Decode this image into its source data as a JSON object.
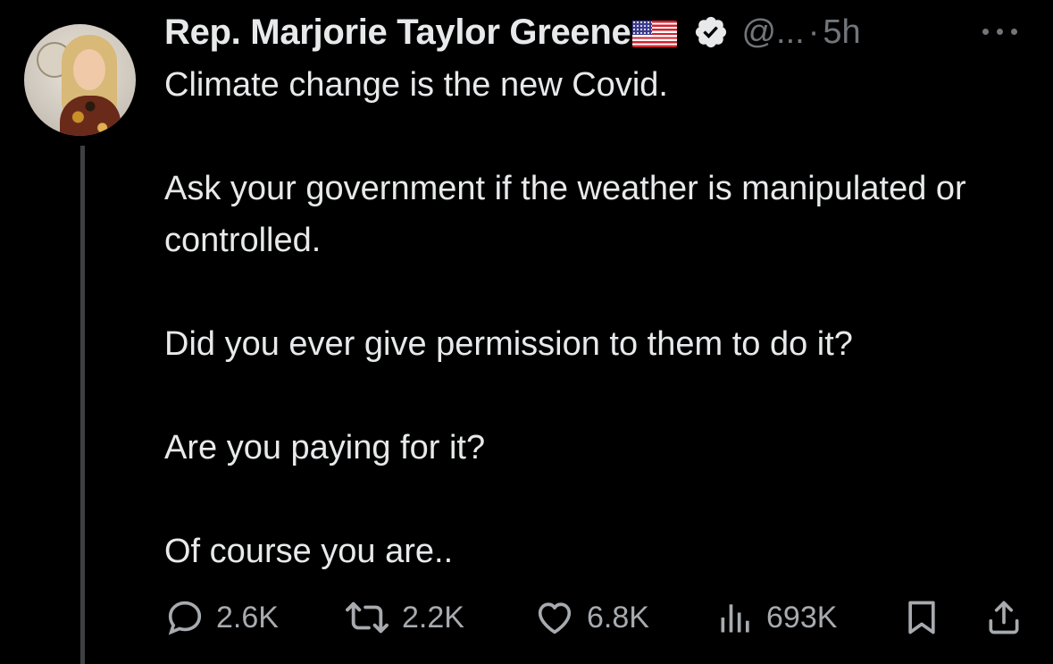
{
  "tweet": {
    "author_name": "Rep. Marjorie Taylor Greene",
    "flag_emoji_name": "us-flag-icon",
    "handle": "@...",
    "separator": "·",
    "time": "5h",
    "paragraphs": [
      "Climate change is the new Covid.",
      "Ask your government if the weather is manipulated or controlled.",
      "Did you ever give permission to them to do it?",
      "Are you paying for it?",
      "Of course you are.."
    ]
  },
  "actions": {
    "replies": "2.6K",
    "reposts": "2.2K",
    "likes": "6.8K",
    "views": "693K"
  },
  "colors": {
    "background": "#000000",
    "text_primary": "#e7e9ea",
    "text_secondary": "#71767b",
    "verified_badge": "#e7e9ea",
    "thread_line": "#3e4144"
  }
}
